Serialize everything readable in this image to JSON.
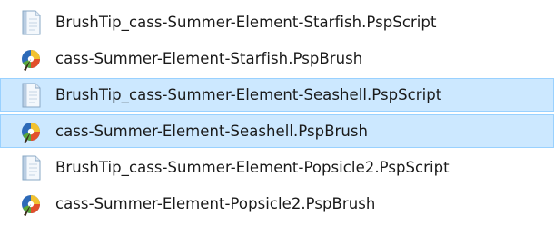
{
  "files": [
    {
      "name": "BrushTip_cass-Summer-Element-Starfish.PspScript",
      "icon": "script-file-icon",
      "selected": false
    },
    {
      "name": "cass-Summer-Element-Starfish.PspBrush",
      "icon": "psp-brush-file-icon",
      "selected": false
    },
    {
      "name": "BrushTip_cass-Summer-Element-Seashell.PspScript",
      "icon": "script-file-icon",
      "selected": true
    },
    {
      "name": "cass-Summer-Element-Seashell.PspBrush",
      "icon": "psp-brush-file-icon",
      "selected": true
    },
    {
      "name": "BrushTip_cass-Summer-Element-Popsicle2.PspScript",
      "icon": "script-file-icon",
      "selected": false
    },
    {
      "name": "cass-Summer-Element-Popsicle2.PspBrush",
      "icon": "psp-brush-file-icon",
      "selected": false
    }
  ],
  "colors": {
    "selection_background": "#cce8ff",
    "selection_border": "#99d1ff",
    "text": "#1a1a1a"
  }
}
